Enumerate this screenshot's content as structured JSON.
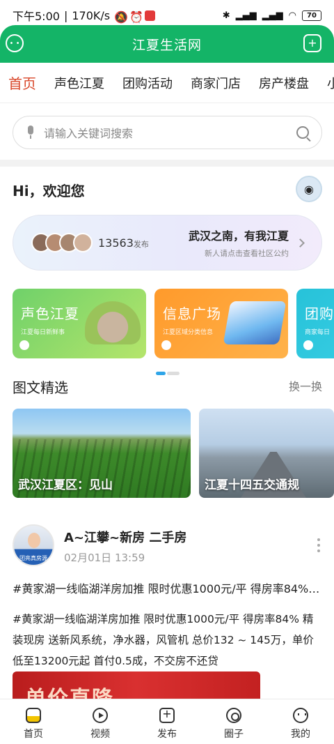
{
  "status": {
    "time": "下午5:00",
    "speed": "170K/s",
    "battery": "70"
  },
  "header": {
    "title": "江夏生活网"
  },
  "tabs": [
    "首页",
    "声色江夏",
    "团购活动",
    "商家门店",
    "房产楼盘",
    "小夏"
  ],
  "search": {
    "placeholder": "请输入关键词搜索"
  },
  "greeting": "Hi，欢迎您",
  "welcome": {
    "count": "13563",
    "count_unit": "发布",
    "motto": "武汉之南，有我江夏",
    "hint": "新人请点击查看社区公约"
  },
  "cards": [
    {
      "title": "声色江夏",
      "subtitle": "江夏每日新鲜事"
    },
    {
      "title": "信息广场",
      "subtitle": "江夏区域分类信息"
    },
    {
      "title": "团购",
      "subtitle": "商家每日"
    }
  ],
  "section": {
    "title": "图文精选",
    "more": "换一换"
  },
  "pictures": [
    {
      "caption": "武汉江夏区：见山"
    },
    {
      "caption": "江夏十四五交通规"
    }
  ],
  "post": {
    "author": "A~江攀~新房 二手房",
    "time": "02月01日 13:59",
    "avatar_tag": "团亮真房源",
    "headline": "#黄家湖一线临湖洋房加推 限时优惠1000元/平 得房率84% 精装现房",
    "body": "#黄家湖一线临湖洋房加推 限时优惠1000元/平 得房率84% 精装现房 送新风系统，净水器，风管机 总价132 ~ 145万，单价低至13200元起 首付0.5成，不交房不还贷",
    "image_text": "单价直降"
  },
  "bottom_nav": [
    "首页",
    "视频",
    "发布",
    "圈子",
    "我的"
  ],
  "colors": {
    "brand": "#14b467",
    "active_tab": "#d9472a"
  }
}
